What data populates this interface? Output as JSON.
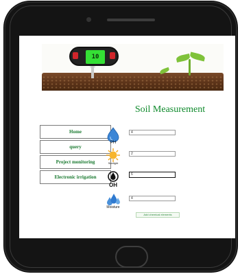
{
  "banner": {
    "meter_reading": "10",
    "soil_color": "#5a3218"
  },
  "title": "Soil Measurement",
  "nav": {
    "items": [
      {
        "label": "Home"
      },
      {
        "label": "query"
      },
      {
        "label": "Project monitoring"
      },
      {
        "label": "Electronic irrigation"
      }
    ]
  },
  "measurements": {
    "ph": {
      "label": "PH",
      "icon": "water-drop-ph-icon",
      "value": "4"
    },
    "sunlight": {
      "label": "Sunlight",
      "icon": "sun-icon",
      "value": "2"
    },
    "oh": {
      "label": "OH",
      "icon": "hydroxide-icon",
      "value": "6"
    },
    "moisture": {
      "label": "Moisture",
      "icon": "water-drops-icon",
      "value": "4"
    }
  },
  "actions": {
    "add_label": "Add chemical elements"
  },
  "colors": {
    "accent": "#0f8a2c",
    "phone": "#141414"
  }
}
